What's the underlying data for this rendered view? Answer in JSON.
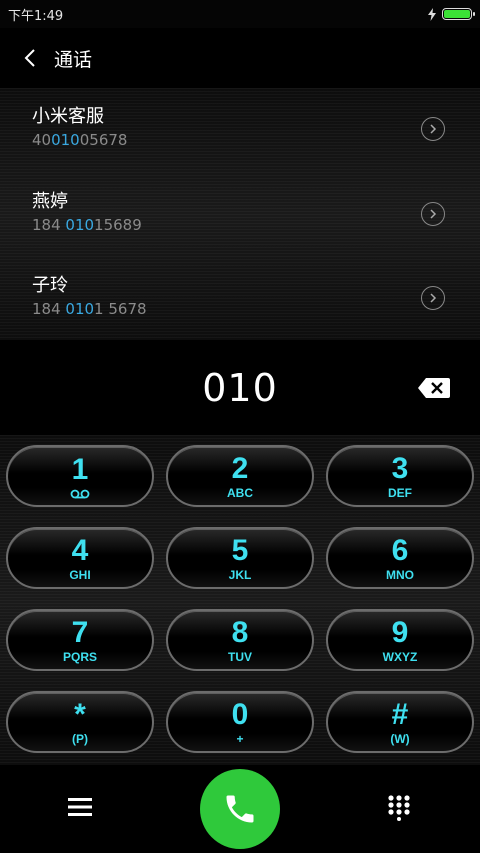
{
  "status_bar": {
    "time": "下午1:49",
    "battery_percent": 100
  },
  "header": {
    "title": "通话"
  },
  "contacts": [
    {
      "name": "小米客服",
      "number_pre": "40",
      "number_match": "010",
      "number_post": "05678"
    },
    {
      "name": "燕婷",
      "number_pre": "184 ",
      "number_match": "010",
      "number_post": "15689"
    },
    {
      "name": "子玲",
      "number_pre": "184 ",
      "number_match": "010",
      "number_post": "1 5678"
    }
  ],
  "dial_input": {
    "value": "010"
  },
  "keys": [
    {
      "digit": "1",
      "letters": ""
    },
    {
      "digit": "2",
      "letters": "ABC"
    },
    {
      "digit": "3",
      "letters": "DEF"
    },
    {
      "digit": "4",
      "letters": "GHI"
    },
    {
      "digit": "5",
      "letters": "JKL"
    },
    {
      "digit": "6",
      "letters": "MNO"
    },
    {
      "digit": "7",
      "letters": "PQRS"
    },
    {
      "digit": "8",
      "letters": "TUV"
    },
    {
      "digit": "9",
      "letters": "WXYZ"
    },
    {
      "digit": "*",
      "letters": "(P)"
    },
    {
      "digit": "0",
      "letters": "+"
    },
    {
      "digit": "#",
      "letters": "(W)"
    }
  ],
  "colors": {
    "accent": "#3fe0f0",
    "match": "#3aa8e0",
    "call": "#2fc93b",
    "battery": "#3be236"
  }
}
